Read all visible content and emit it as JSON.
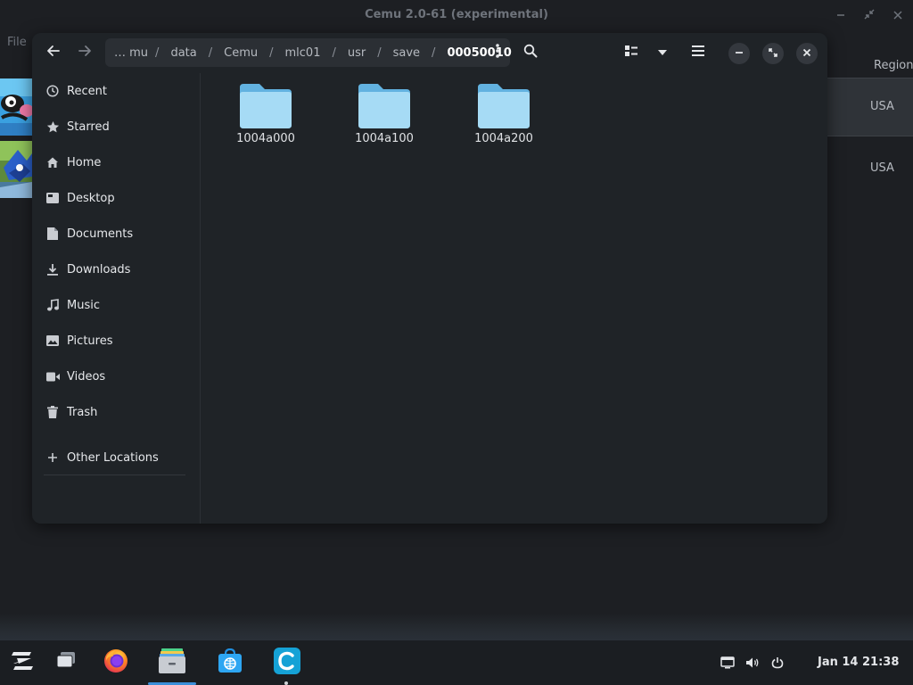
{
  "background_app": {
    "title": "Cemu 2.0-61 (experimental)",
    "menu": [
      "File"
    ],
    "columns": {
      "region": "Region"
    },
    "rows": [
      {
        "region": "USA",
        "selected": true
      },
      {
        "region": "USA",
        "selected": false
      }
    ],
    "window_controls": [
      "minimize-icon",
      "restore-icon",
      "close-icon"
    ]
  },
  "dialog": {
    "nav": {
      "back_icon": "arrow-left-icon",
      "forward_icon": "arrow-right-icon"
    },
    "path": {
      "crumbs": [
        "… mu",
        "data",
        "Cemu",
        "mlc01",
        "usr",
        "save",
        "00050010"
      ],
      "current": "00050010",
      "separator": "/"
    },
    "toolbar": {
      "search_icon": "search-icon",
      "view_icon": "list-view-icon",
      "view_dropdown_icon": "chevron-down-icon",
      "menu_icon": "hamburger-menu-icon"
    },
    "window_controls": [
      "minimize-icon",
      "maximize-icon",
      "close-icon"
    ],
    "sidebar": {
      "items": [
        {
          "label": "Recent",
          "icon": "clock-icon"
        },
        {
          "label": "Starred",
          "icon": "star-icon"
        },
        {
          "label": "Home",
          "icon": "home-icon"
        },
        {
          "label": "Desktop",
          "icon": "desktop-icon"
        },
        {
          "label": "Documents",
          "icon": "document-icon"
        },
        {
          "label": "Downloads",
          "icon": "download-icon"
        },
        {
          "label": "Music",
          "icon": "music-icon"
        },
        {
          "label": "Pictures",
          "icon": "picture-icon"
        },
        {
          "label": "Videos",
          "icon": "video-icon"
        },
        {
          "label": "Trash",
          "icon": "trash-icon"
        }
      ],
      "other_locations": {
        "label": "Other Locations",
        "icon": "plus-icon"
      }
    },
    "folders": [
      {
        "name": "1004a000"
      },
      {
        "name": "1004a100"
      },
      {
        "name": "1004a200"
      }
    ],
    "folder_color": "#7cc3ea"
  },
  "taskbar": {
    "apps": [
      {
        "name": "zorin-menu-icon"
      },
      {
        "name": "workspaces-icon"
      },
      {
        "name": "firefox-icon"
      },
      {
        "name": "files-icon",
        "active": true
      },
      {
        "name": "software-store-icon"
      },
      {
        "name": "cemu-icon",
        "running": true
      }
    ],
    "tray": [
      "display-icon",
      "volume-icon",
      "power-icon"
    ],
    "clock": "Jan 14  21:38",
    "accent": "#3b8fd9"
  }
}
